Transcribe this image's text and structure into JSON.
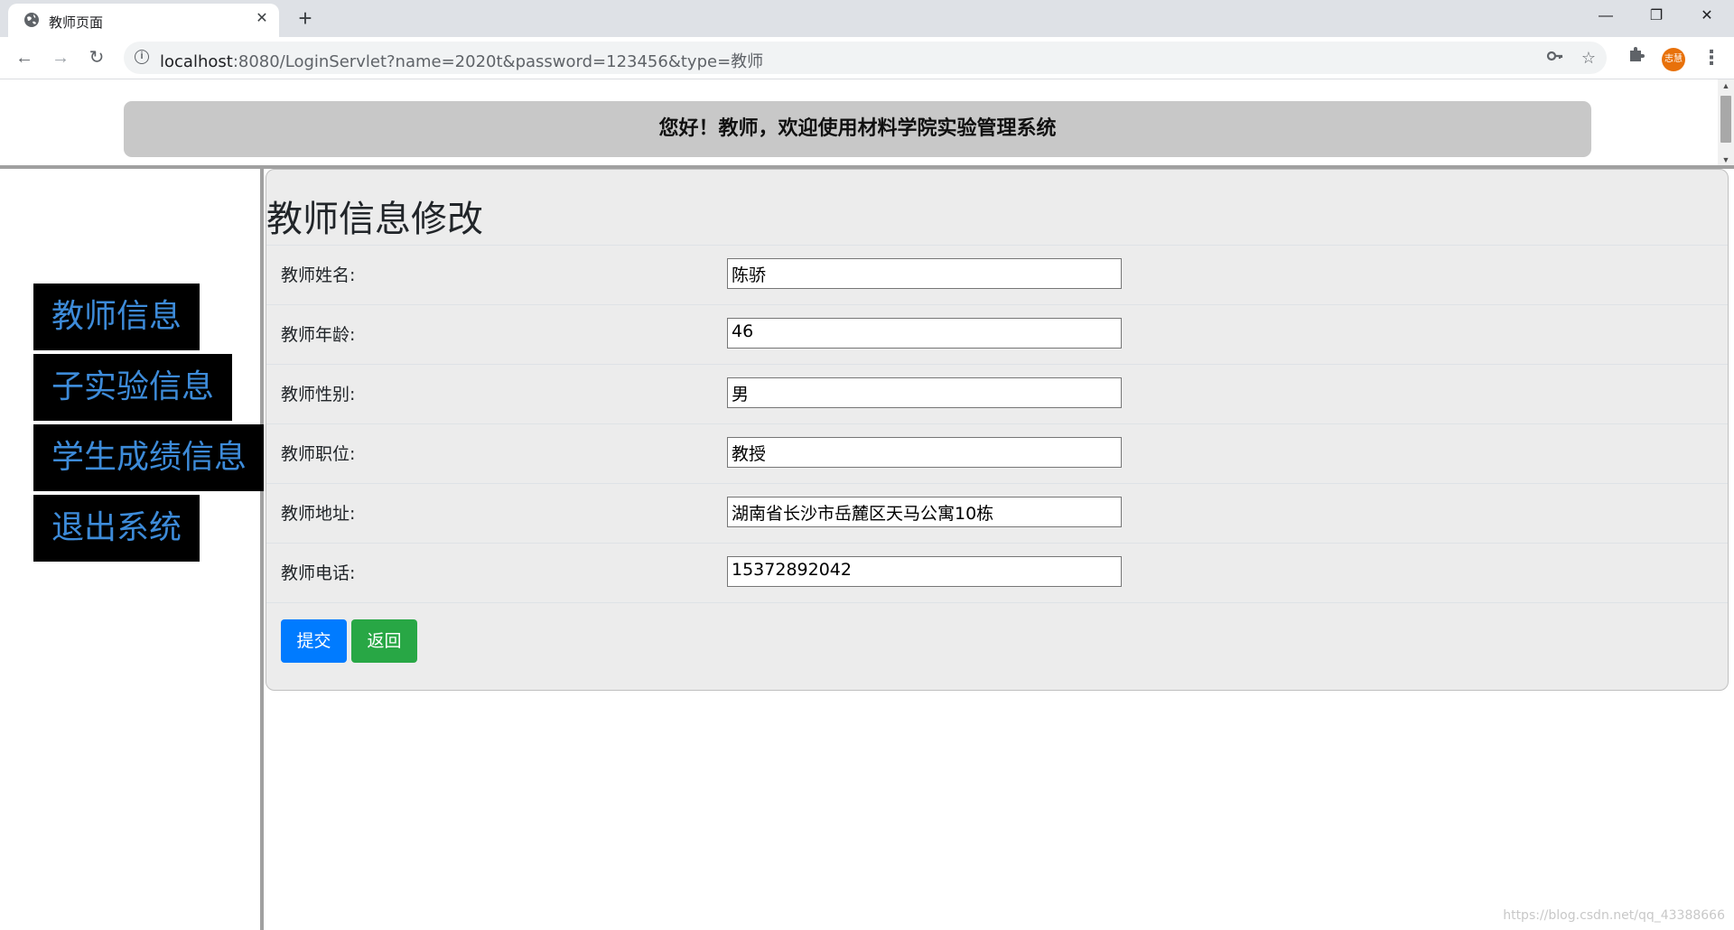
{
  "browser": {
    "tab_title": "教师页面",
    "tab_close": "✕",
    "new_tab": "+",
    "window_controls": {
      "minimize": "—",
      "maximize": "❐",
      "close": "✕"
    },
    "nav": {
      "back": "←",
      "forward": "→",
      "reload": "↻"
    },
    "url_host": "localhost",
    "url_rest": ":8080/LoginServlet?name=2020t&password=123456&type=教师",
    "icons": [
      "globe-icon",
      "info-icon",
      "key-icon",
      "star-icon",
      "puzzle-icon",
      "menu-icon"
    ],
    "profile_text": "志慧",
    "accent_profile": "#e8710a"
  },
  "header": {
    "welcome": "您好！教师，欢迎使用材料学院实验管理系统"
  },
  "sidebar": {
    "items": [
      {
        "label": "教师信息"
      },
      {
        "label": "子实验信息"
      },
      {
        "label": "学生成绩信息"
      },
      {
        "label": "退出系统"
      }
    ],
    "text_color": "#3d8bd9"
  },
  "form": {
    "title": "教师信息修改",
    "fields": [
      {
        "label": "教师姓名:",
        "value": "陈骄"
      },
      {
        "label": "教师年龄:",
        "value": "46"
      },
      {
        "label": "教师性别:",
        "value": "男"
      },
      {
        "label": "教师职位:",
        "value": "教授"
      },
      {
        "label": "教师地址:",
        "value": "湖南省长沙市岳麓区天马公寓10栋"
      },
      {
        "label": "教师电话:",
        "value": "15372892042"
      }
    ],
    "submit_label": "提交",
    "back_label": "返回",
    "submit_color": "#007bff",
    "back_color": "#28a745"
  },
  "watermark": "https://blog.csdn.net/qq_43388666"
}
